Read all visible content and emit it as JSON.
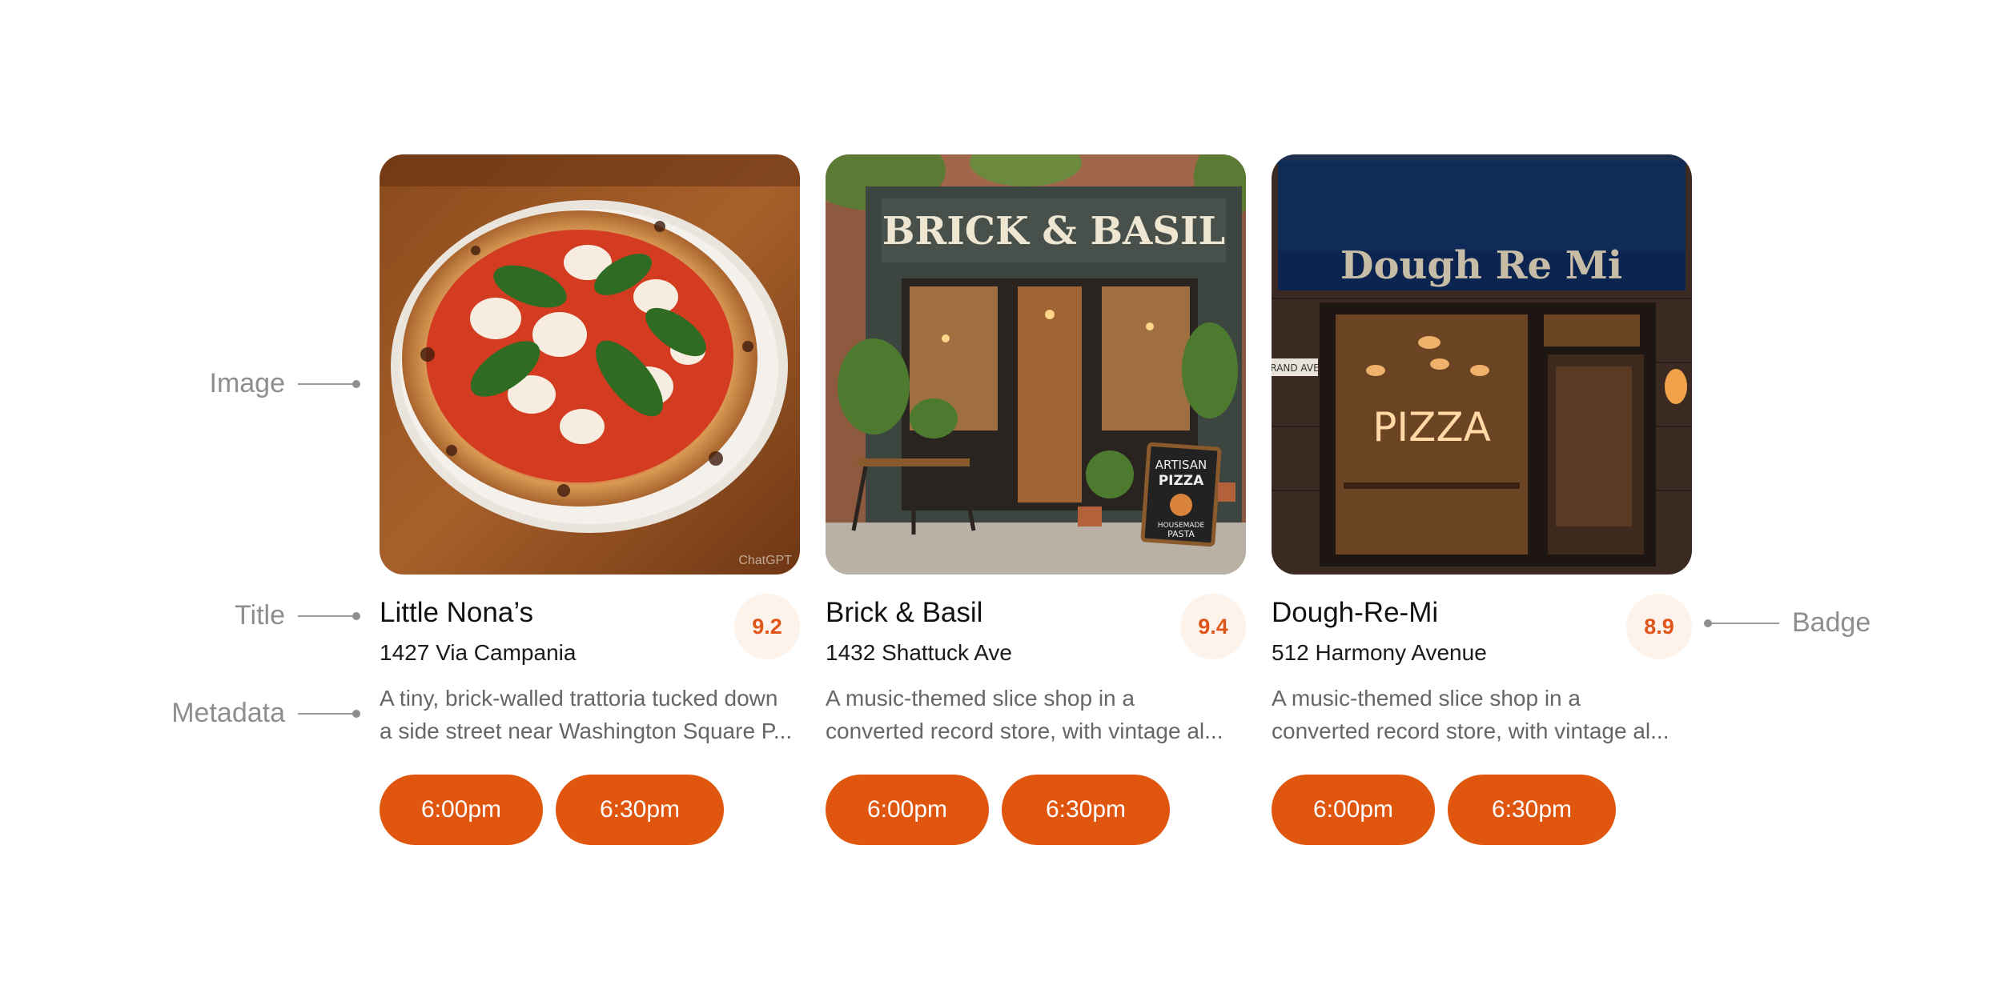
{
  "annotations": {
    "image": "Image",
    "title": "Title",
    "metadata": "Metadata",
    "badge": "Badge"
  },
  "cards": [
    {
      "title": "Little Nona’s",
      "address": "1427 Via Campania",
      "rating": "9.2",
      "description_line1": "A tiny, brick-walled trattoria tucked down",
      "description_line2": "a side street near Washington Square P...",
      "times": [
        "6:00pm",
        "6:30pm"
      ],
      "image_watermark": "ChatGPT"
    },
    {
      "title": "Brick & Basil",
      "address": "1432 Shattuck Ave",
      "rating": "9.4",
      "description_line1": "A music-themed slice shop in a",
      "description_line2": "converted record store, with vintage al...",
      "times": [
        "6:00pm",
        "6:30pm"
      ],
      "image_sign": "BRICK & BASIL",
      "image_board_line1": "ARTISAN",
      "image_board_line2": "PIZZA",
      "image_board_line3": "HOUSEMADE",
      "image_board_line4": "PASTA"
    },
    {
      "title": "Dough-Re-Mi",
      "address": "512 Harmony Avenue",
      "rating": "8.9",
      "description_line1": "A music-themed slice shop in a",
      "description_line2": "converted record store, with vintage al...",
      "times": [
        "6:00pm",
        "6:30pm"
      ],
      "image_sign": "Dough Re Mi",
      "image_neon": "PIZZA",
      "image_street": "RAND AVE"
    }
  ],
  "colors": {
    "accent": "#e0560f",
    "badge_bg": "#fdf3ea",
    "badge_text": "#e0561a",
    "annotation": "#8e8e8e"
  }
}
